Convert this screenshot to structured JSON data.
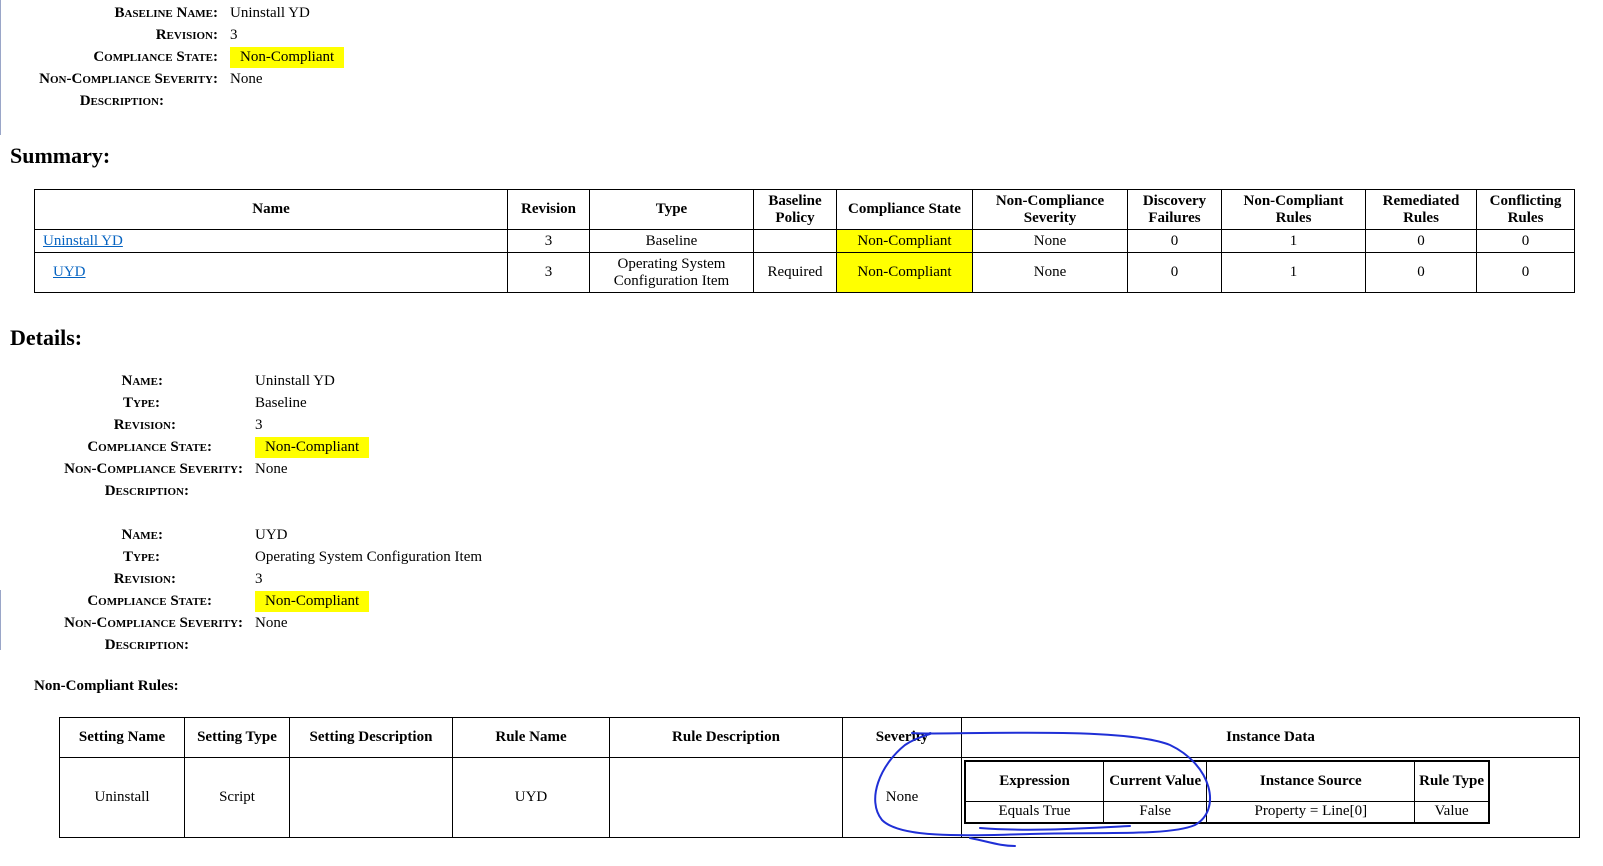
{
  "header": {
    "baseline_name_label": "Baseline Name:",
    "baseline_name": "Uninstall YD",
    "revision_label": "Revision:",
    "revision": "3",
    "compliance_state_label": "Compliance State:",
    "compliance_state": "Non-Compliant",
    "severity_label": "Non-Compliance Severity:",
    "severity": "None",
    "description_label": "Description:"
  },
  "summary": {
    "title": "Summary:",
    "columns": [
      "Name",
      "Revision",
      "Type",
      "Baseline Policy",
      "Compliance State",
      "Non-Compliance Severity",
      "Discovery Failures",
      "Non-Compliant Rules",
      "Remediated Rules",
      "Conflicting Rules"
    ],
    "rows": [
      {
        "name": "Uninstall YD",
        "revision": "3",
        "type": "Baseline",
        "policy": "",
        "state": "Non-Compliant",
        "severity": "None",
        "discovery": "0",
        "noncompliant": "1",
        "remediated": "0",
        "conflicting": "0"
      },
      {
        "name": "UYD",
        "revision": "3",
        "type": "Operating System Configuration Item",
        "policy": "Required",
        "state": "Non-Compliant",
        "severity": "None",
        "discovery": "0",
        "noncompliant": "1",
        "remediated": "0",
        "conflicting": "0"
      }
    ]
  },
  "details": {
    "title": "Details:",
    "labels": {
      "name": "Name:",
      "type": "Type:",
      "revision": "Revision:",
      "state": "Compliance State:",
      "severity": "Non-Compliance Severity:",
      "description": "Description:"
    },
    "items": [
      {
        "name": "Uninstall YD",
        "type": "Baseline",
        "revision": "3",
        "state": "Non-Compliant",
        "severity": "None"
      },
      {
        "name": "UYD",
        "type": "Operating System Configuration Item",
        "revision": "3",
        "state": "Non-Compliant",
        "severity": "None"
      }
    ]
  },
  "rules": {
    "title": "Non-Compliant Rules:",
    "columns": [
      "Setting Name",
      "Setting Type",
      "Setting Description",
      "Rule Name",
      "Rule Description",
      "Severity",
      "Instance Data"
    ],
    "row": {
      "setting_name": "Uninstall",
      "setting_type": "Script",
      "setting_description": "",
      "rule_name": "UYD",
      "rule_description": "",
      "severity": "None"
    },
    "instance": {
      "columns": [
        "Expression",
        "Current Value",
        "Instance Source",
        "Rule Type"
      ],
      "row": {
        "expression": "Equals True",
        "current_value": "False",
        "instance_source": "Property = Line[0]",
        "rule_type": "Value"
      }
    }
  },
  "colors": {
    "highlight": "#ffff00",
    "link": "#0563c1",
    "scribble": "#1f2fd6"
  }
}
